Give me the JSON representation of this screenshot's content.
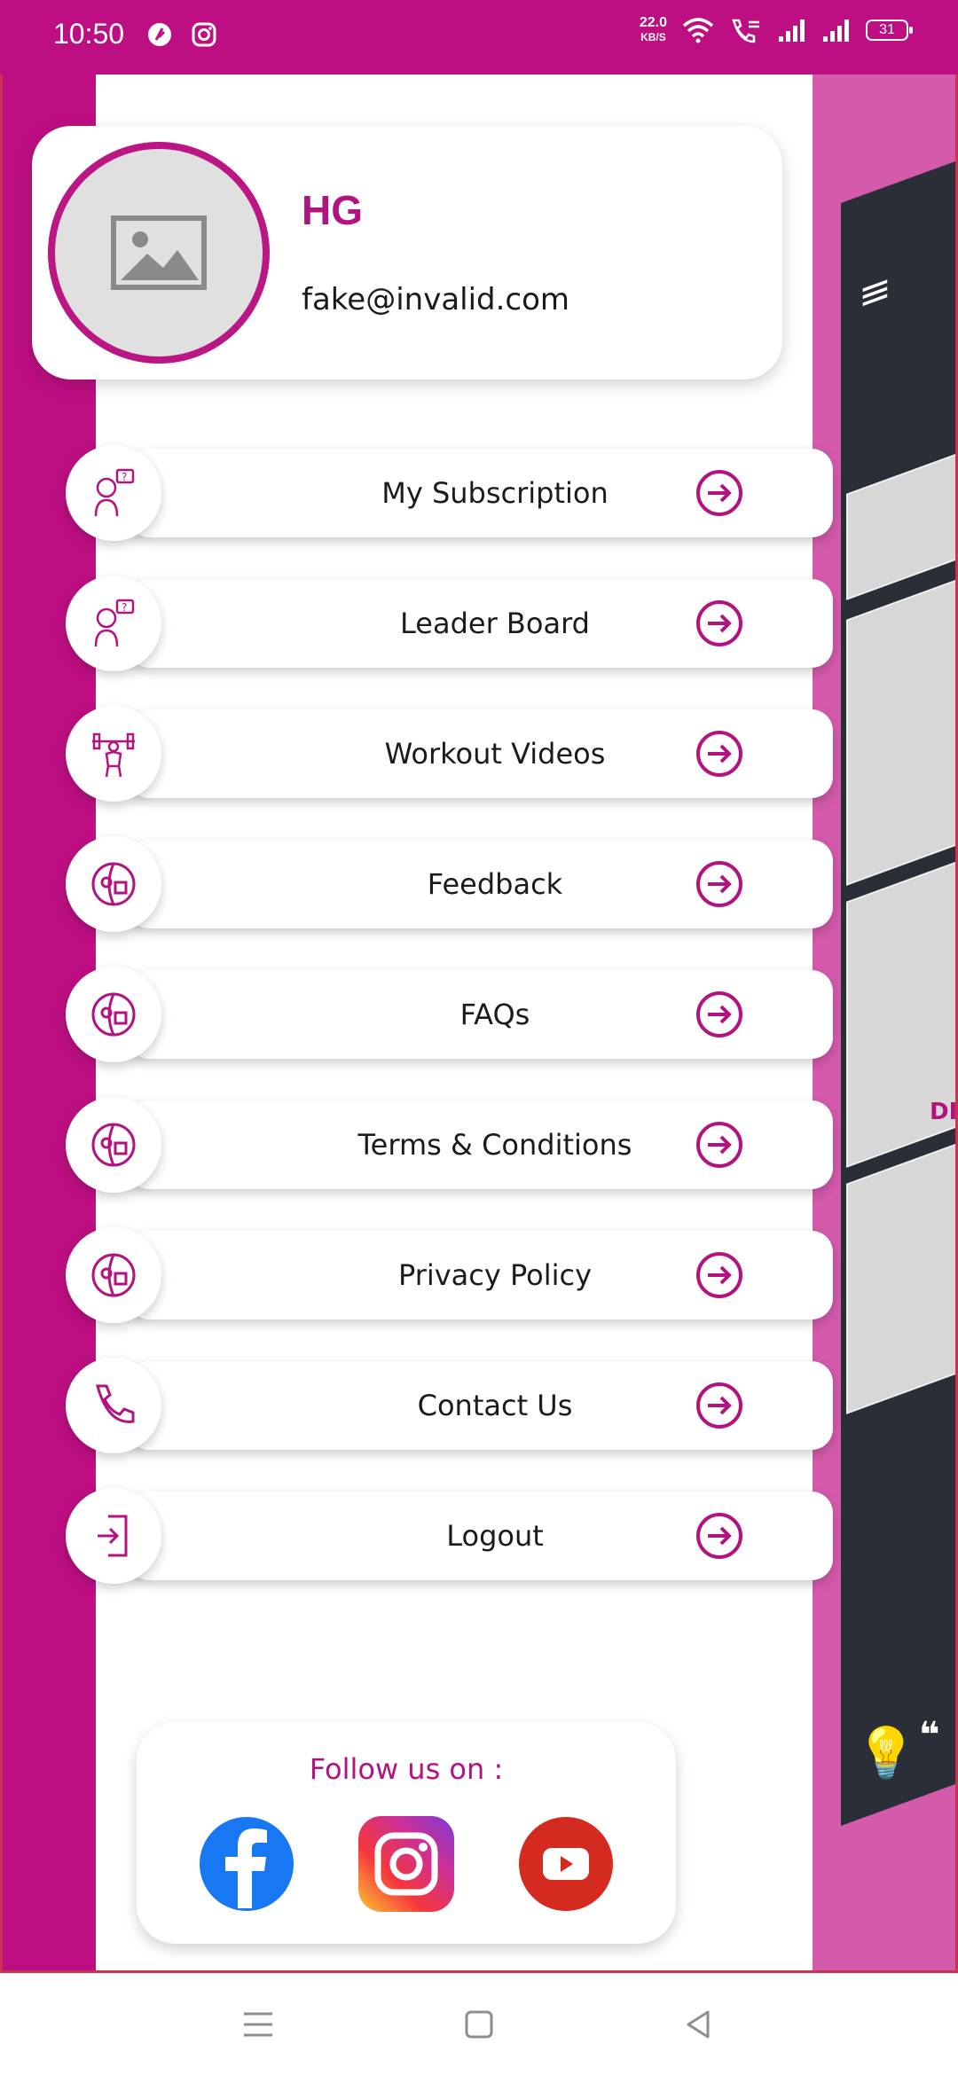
{
  "status_bar": {
    "time": "10:50",
    "net_speed": "22.0",
    "net_speed_unit": "KB/S",
    "battery": "31"
  },
  "profile": {
    "name": "HG",
    "email": "fake@invalid.com"
  },
  "menu": [
    {
      "label": "My Subscription",
      "icon": "support-agent-icon"
    },
    {
      "label": "Leader Board",
      "icon": "support-agent-icon"
    },
    {
      "label": "Workout Videos",
      "icon": "weightlifter-icon"
    },
    {
      "label": "Feedback",
      "icon": "chat-faces-icon"
    },
    {
      "label": "FAQs",
      "icon": "chat-faces-icon"
    },
    {
      "label": "Terms & Conditions",
      "icon": "chat-faces-icon"
    },
    {
      "label": "Privacy Policy",
      "icon": "chat-faces-icon"
    },
    {
      "label": "Contact Us",
      "icon": "phone-icon"
    },
    {
      "label": "Logout",
      "icon": "logout-icon"
    }
  ],
  "follow": {
    "title": "Follow us on :",
    "networks": [
      "facebook-icon",
      "instagram-icon",
      "youtube-icon"
    ]
  },
  "background_preview": {
    "partial_text": "DI"
  },
  "colors": {
    "brand": "#bd0f82",
    "accent_text": "#b2137f",
    "panel_pink": "#d45aac"
  }
}
